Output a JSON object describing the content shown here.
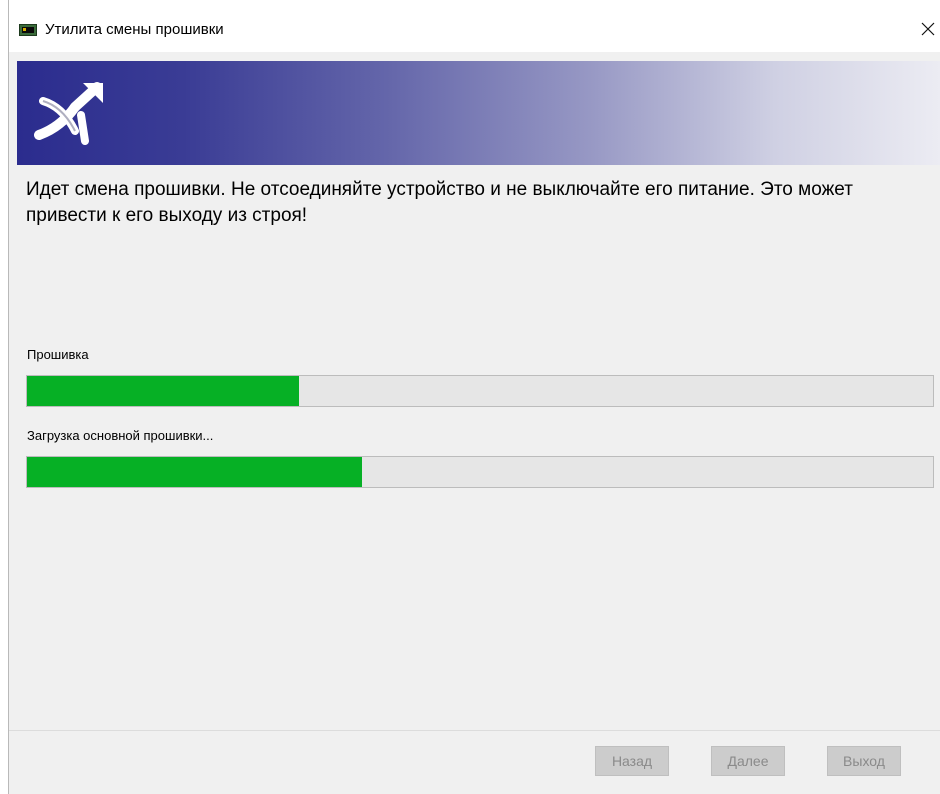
{
  "window": {
    "title": "Утилита смены прошивки",
    "icons": {
      "app": "firmware-board-icon",
      "close": "close-icon",
      "banner": "arrow-logo-icon"
    }
  },
  "main": {
    "message": "Идет смена прошивки. Не отсоединяйте устройство и не выключайте его питание. Это может привести к его выходу из строя!"
  },
  "progress": {
    "overall": {
      "label": "Прошивка",
      "fraction": 0.3
    },
    "current": {
      "label": "Загрузка основной прошивки...",
      "fraction": 0.37
    },
    "fill_color": "#06b025"
  },
  "buttons": {
    "back": "Назад",
    "next": "Далее",
    "exit": "Выход",
    "disabled": true
  },
  "colors": {
    "banner_start": "#2b2c8e",
    "banner_end": "#ececf3"
  }
}
